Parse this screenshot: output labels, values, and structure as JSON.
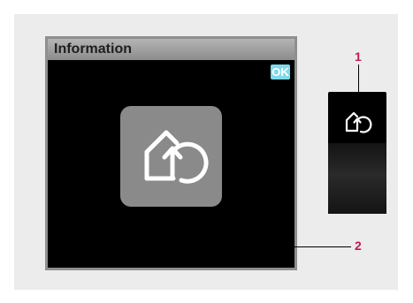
{
  "window": {
    "title": "Information",
    "ok_label": "OK"
  },
  "app_icon": "home-return-icon",
  "device_icon": "home-return-icon",
  "callouts": {
    "one": "1",
    "two": "2"
  },
  "colors": {
    "ok_badge": "#7fd9ea",
    "callout": "#c01a4e",
    "tile": "#8a8a8a"
  }
}
